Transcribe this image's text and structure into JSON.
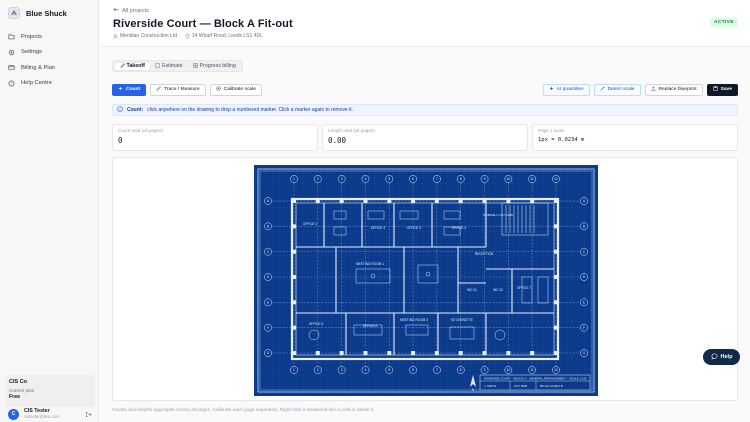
{
  "app": {
    "name": "Blue Shuck"
  },
  "sidebar": {
    "items": [
      {
        "label": "Projects",
        "icon": "folder-icon"
      },
      {
        "label": "Settings",
        "icon": "gear-icon"
      },
      {
        "label": "Billing & Plan",
        "icon": "card-icon"
      },
      {
        "label": "Help Centre",
        "icon": "help-icon"
      }
    ],
    "org": {
      "name": "CIS Co",
      "plan_label": "Current plan",
      "plan": "Free"
    },
    "user": {
      "initial": "C",
      "name": "CIS Tester",
      "email": "cistester@test.com"
    }
  },
  "header": {
    "back_label": "All projects",
    "title": "Riverside Court — Block A Fit-out",
    "company": "Meridian Construction Ltd",
    "address": "14 Wharf Road, Leeds LS1 4DL",
    "status": "ACTIVE"
  },
  "tabs": [
    {
      "label": "Takeoff",
      "icon": "ruler-icon",
      "active": true
    },
    {
      "label": "Estimate",
      "icon": "doc-icon",
      "active": false
    },
    {
      "label": "Progress billing",
      "icon": "grid-icon",
      "active": false
    }
  ],
  "toolbar": {
    "count": "Count",
    "trace": "Trace / Measure",
    "calibrate": "Calibrate scale",
    "ai_quantities": "AI quantities",
    "detect_scale": "Detect scale",
    "replace_blueprint": "Replace blueprint",
    "save": "Save"
  },
  "info": {
    "label": "Count:",
    "text": "click anywhere on the drawing to drop a numbered marker. Click a marker again to remove it."
  },
  "stats": {
    "count_label": "Count total (all pages)",
    "count_value": "0",
    "length_label": "Length total (all pages)",
    "length_value": "0.00",
    "scale_label": "Page 1 scale",
    "scale_value": "1px = 0.0234 m"
  },
  "blueprint": {
    "columns": [
      "1",
      "2",
      "3",
      "4",
      "5",
      "6",
      "7",
      "8",
      "9",
      "10",
      "11",
      "12"
    ],
    "rows": [
      "A",
      "B",
      "C",
      "D",
      "E",
      "F",
      "G"
    ],
    "rooms": {
      "office1": "OFFICE 1",
      "office2": "OFFICE 2",
      "office3": "OFFICE 3",
      "office4": "OFFICE 4",
      "office5": "OFFICE 5",
      "office6": "OFFICE 6",
      "office7": "OFFICE 7",
      "meeting1": "MEETING ROOM 1",
      "meeting2": "MEETING ROOM 2",
      "reception": "RECEPTION",
      "stairwell": "STAIRWELL / LIFT CORE",
      "wc1": "WC 01",
      "wc2": "WC 02",
      "kitchen": "KITCHENETTE"
    },
    "title_block": {
      "title": "RIVERSIDE COURT – BLOCK A – GENERAL ARRANGEMENT – SCALE 1:100",
      "drawn": "J. SMITH",
      "date": "OCT 2025",
      "drg": "BS-GA-01 REV B",
      "north": "N"
    }
  },
  "footer": {
    "note": "Counts and lengths aggregate across all pages. Calibrate each page separately. Right-click a measured line to edit or delete it."
  },
  "help": {
    "label": "Help"
  },
  "colors": {
    "accent": "#2563eb",
    "blueprint": "#0b3a8a",
    "active_badge": "#15803d"
  }
}
